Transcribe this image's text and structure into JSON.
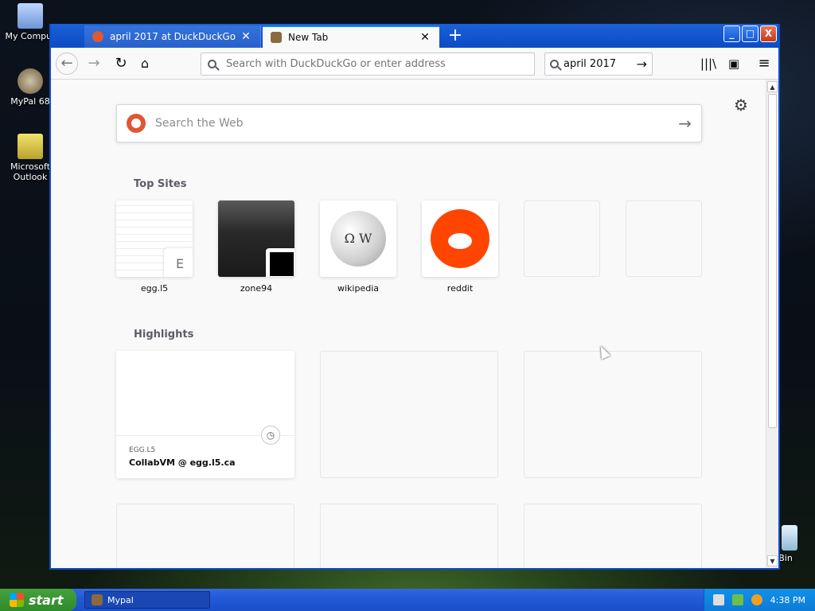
{
  "desktop": {
    "icons": [
      {
        "label": "My Comput"
      },
      {
        "label": "MyPal 68"
      },
      {
        "label": "Microsoft Outlook"
      },
      {
        "label": "e Bin"
      }
    ]
  },
  "browser": {
    "tabs": [
      {
        "title": "april 2017 at DuckDuckGo",
        "active": false
      },
      {
        "title": "New Tab",
        "active": true
      }
    ],
    "new_tab_label": "+",
    "window_buttons": {
      "minimize": "_",
      "maximize": "□",
      "close": "X"
    },
    "url_bar": {
      "placeholder": "Search with DuckDuckGo or enter address"
    },
    "search_bar": {
      "value": "april 2017"
    },
    "toolbar_icons": [
      "back-icon",
      "forward-icon",
      "reload-icon",
      "home-icon",
      "library-icon",
      "sidebar-icon",
      "menu-icon"
    ]
  },
  "newtab": {
    "search": {
      "placeholder": "Search the Web"
    },
    "top_sites_title": "Top Sites",
    "top_sites": [
      {
        "label": "egg.l5",
        "badge": "E"
      },
      {
        "label": "zone94"
      },
      {
        "label": "wikipedia"
      },
      {
        "label": "reddit"
      },
      {
        "label": ""
      },
      {
        "label": ""
      }
    ],
    "highlights_title": "Highlights",
    "highlights": [
      {
        "host": "EGG.L5",
        "title": "CollabVM @ egg.l5.ca"
      }
    ]
  },
  "taskbar": {
    "start_label": "start",
    "task_label": "Mypal",
    "clock": "4:38 PM"
  },
  "colors": {
    "xp_blue": "#245ad7",
    "accent": "#0a84ff",
    "ddg": "#de5833",
    "reddit": "#ff4500"
  }
}
